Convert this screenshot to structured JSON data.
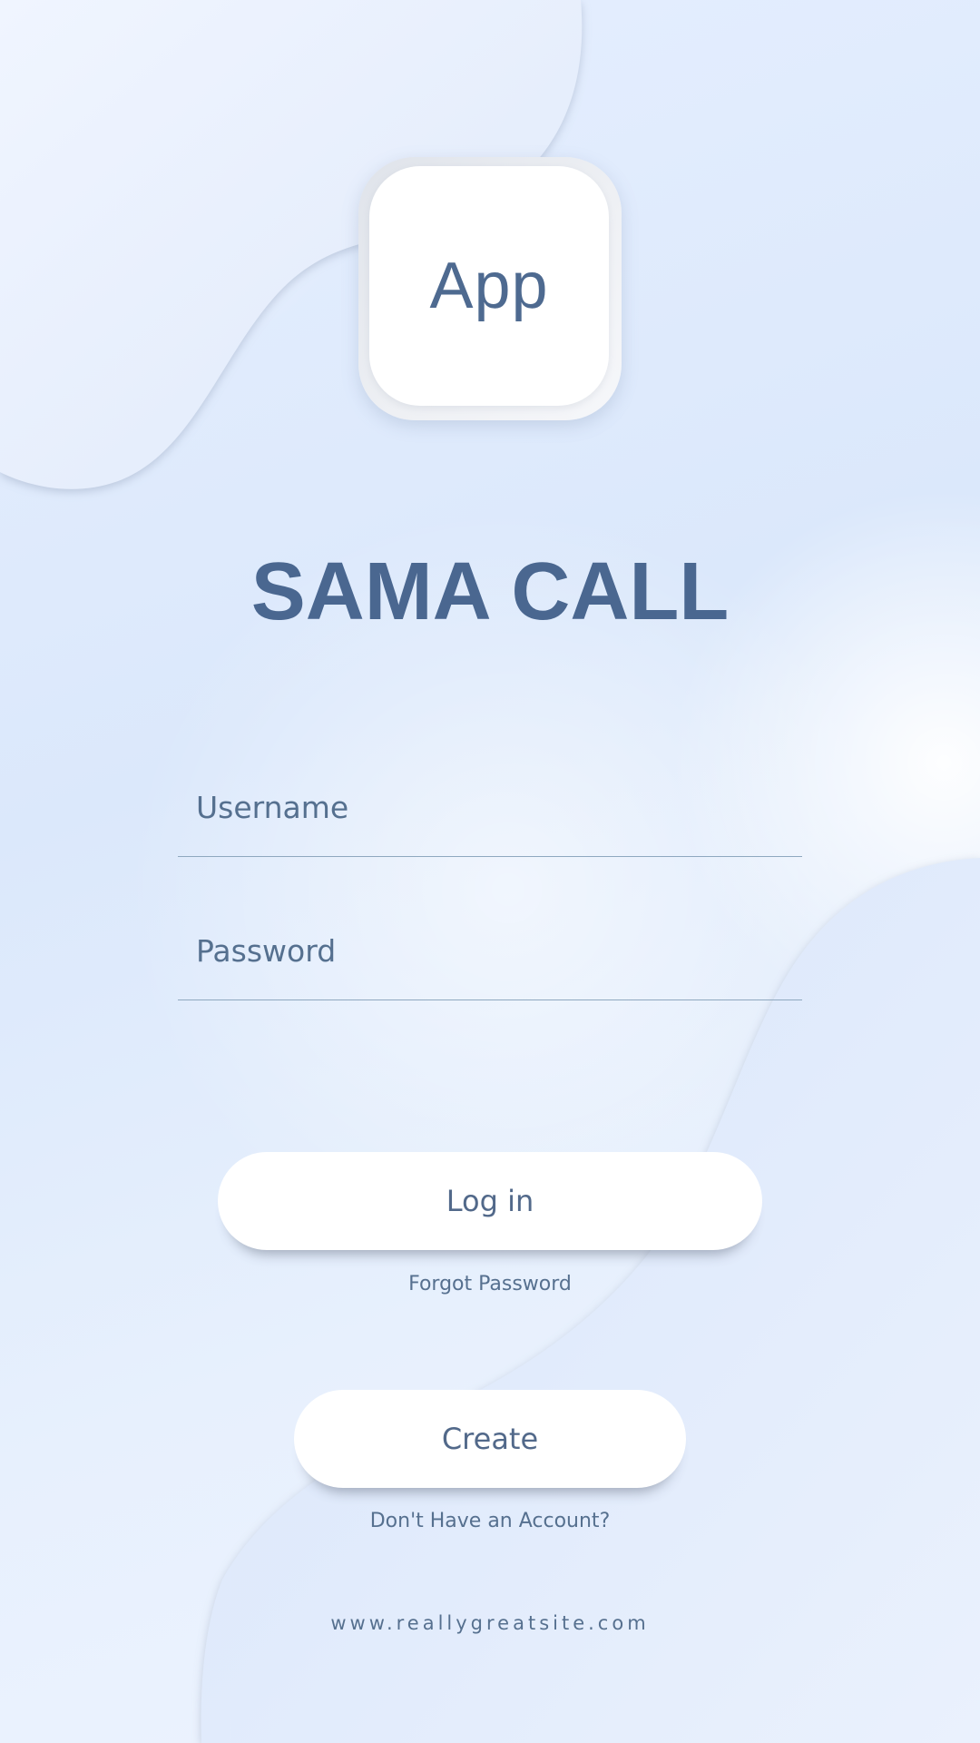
{
  "logo": {
    "text": "App"
  },
  "title": "SAMA CALL",
  "form": {
    "username_placeholder": "Username",
    "password_placeholder": "Password"
  },
  "buttons": {
    "login_label": "Log in",
    "create_label": "Create"
  },
  "links": {
    "forgot_password": "Forgot Password",
    "no_account": "Don't Have an Account?"
  },
  "footer": {
    "website": "www.reallygreatsite.com"
  },
  "colors": {
    "accent_text": "#4a6790",
    "background": "#dbe8fb",
    "button_bg": "#ffffff"
  }
}
